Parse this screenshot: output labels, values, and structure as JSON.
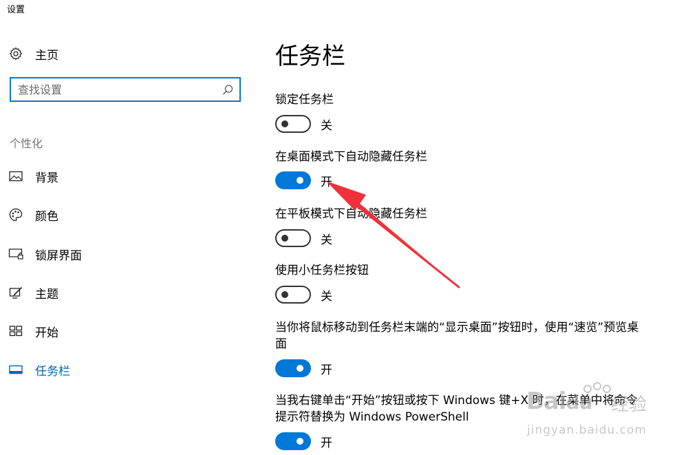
{
  "window": {
    "title": "设置"
  },
  "sidebar": {
    "home_label": "主页",
    "search_placeholder": "查找设置",
    "section_header": "个性化",
    "items": [
      {
        "label": "背景",
        "icon": "image-icon"
      },
      {
        "label": "颜色",
        "icon": "palette-icon"
      },
      {
        "label": "锁屏界面",
        "icon": "lock-screen-icon"
      },
      {
        "label": "主题",
        "icon": "theme-icon"
      },
      {
        "label": "开始",
        "icon": "start-icon"
      },
      {
        "label": "任务栏",
        "icon": "taskbar-icon",
        "active": true
      }
    ]
  },
  "main": {
    "title": "任务栏",
    "settings": [
      {
        "label": "锁定任务栏",
        "state": "关",
        "on": false
      },
      {
        "label": "在桌面模式下自动隐藏任务栏",
        "state": "开",
        "on": true
      },
      {
        "label": "在平板模式下自动隐藏任务栏",
        "state": "关",
        "on": false
      },
      {
        "label": "使用小任务栏按钮",
        "state": "关",
        "on": false
      },
      {
        "label": "当你将鼠标移动到任务栏末端的“显示桌面”按钮时，使用“速览”预览桌面",
        "state": "开",
        "on": true
      },
      {
        "label": "当我右键单击“开始”按钮或按下 Windows 键+X 时，在菜单中将命令提示符替换为 Windows PowerShell",
        "state": "开",
        "on": true
      }
    ]
  },
  "annotation": {
    "arrow_color": "#f0313a"
  },
  "watermark": {
    "brand": "Bai",
    "brand_suffix": "百度",
    "secondary": "经验",
    "url": "jingyan.baidu.com"
  },
  "colors": {
    "accent": "#0078d7",
    "active_text": "#0063b1",
    "muted": "#767676"
  }
}
